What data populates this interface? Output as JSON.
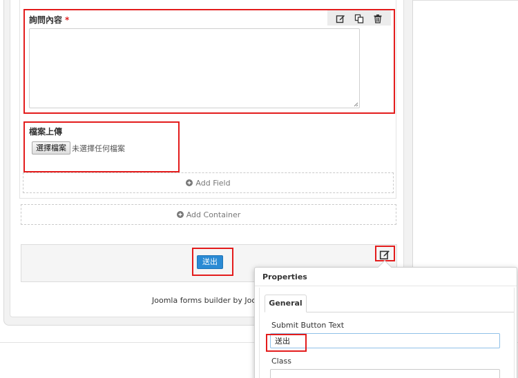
{
  "form": {
    "inquiry_field": {
      "label": "詢問內容",
      "required_mark": "*"
    },
    "upload_field": {
      "label": "檔案上傳",
      "choose_button": "選擇檔案",
      "status": "未選擇任何檔案"
    },
    "add_field_label": "Add Field",
    "add_container_label": "Add Container",
    "submit_button": "送出",
    "footer": "Joomla forms builder by JoomlaSh"
  },
  "tools": [
    "edit-icon",
    "copy-icon",
    "trash-icon"
  ],
  "properties_panel": {
    "title": "Properties",
    "tab": "General",
    "submit_text_label": "Submit Button Text",
    "submit_text_value": "送出",
    "class_label": "Class",
    "class_value": ""
  },
  "colors": {
    "highlight": "#e31b1b",
    "primary_button": "#2a8ad4",
    "input_focus": "#8ec0e8"
  }
}
